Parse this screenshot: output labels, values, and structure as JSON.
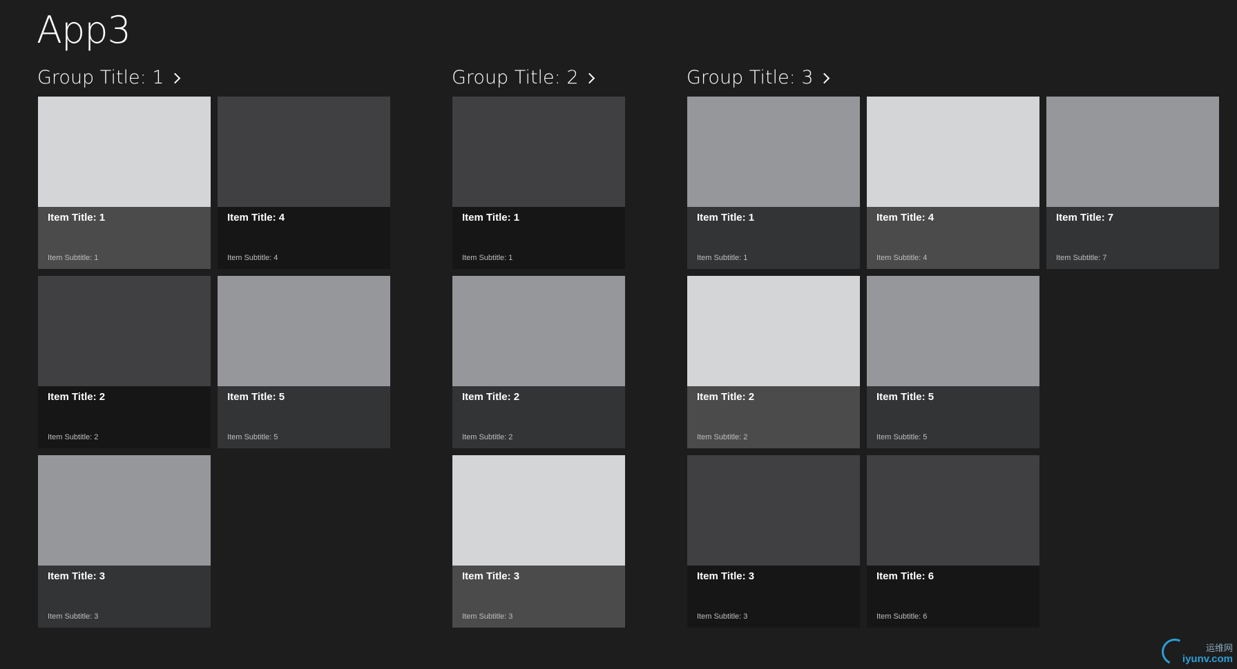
{
  "app": {
    "title": "App3"
  },
  "colors": {
    "background": "#1d1d1d",
    "shade_light": "#d4d5d7",
    "shade_mid": "#96979b",
    "shade_dark": "#404042"
  },
  "groups": [
    {
      "title": "Group Title: 1",
      "items": [
        {
          "title": "Item Title: 1",
          "subtitle": "Item Subtitle: 1",
          "image_color": "#d4d5d7",
          "caption_color": "#4b4b4b"
        },
        {
          "title": "Item Title: 2",
          "subtitle": "Item Subtitle: 2",
          "image_color": "#404042",
          "caption_color": "#161617"
        },
        {
          "title": "Item Title: 3",
          "subtitle": "Item Subtitle: 3",
          "image_color": "#96979b",
          "caption_color": "#333436"
        },
        {
          "title": "Item Title: 4",
          "subtitle": "Item Subtitle: 4",
          "image_color": "#404042",
          "caption_color": "#161617"
        },
        {
          "title": "Item Title: 5",
          "subtitle": "Item Subtitle: 5",
          "image_color": "#96979b",
          "caption_color": "#333436"
        }
      ]
    },
    {
      "title": "Group Title: 2",
      "items": [
        {
          "title": "Item Title: 1",
          "subtitle": "Item Subtitle: 1",
          "image_color": "#404042",
          "caption_color": "#161617"
        },
        {
          "title": "Item Title: 2",
          "subtitle": "Item Subtitle: 2",
          "image_color": "#96979b",
          "caption_color": "#333436"
        },
        {
          "title": "Item Title: 3",
          "subtitle": "Item Subtitle: 3",
          "image_color": "#d4d5d7",
          "caption_color": "#4b4b4b"
        }
      ]
    },
    {
      "title": "Group Title: 3",
      "items": [
        {
          "title": "Item Title: 1",
          "subtitle": "Item Subtitle: 1",
          "image_color": "#96979b",
          "caption_color": "#333436"
        },
        {
          "title": "Item Title: 2",
          "subtitle": "Item Subtitle: 2",
          "image_color": "#d4d5d7",
          "caption_color": "#4b4b4b"
        },
        {
          "title": "Item Title: 3",
          "subtitle": "Item Subtitle: 3",
          "image_color": "#404042",
          "caption_color": "#161617"
        },
        {
          "title": "Item Title: 4",
          "subtitle": "Item Subtitle: 4",
          "image_color": "#d4d5d7",
          "caption_color": "#4b4b4b"
        },
        {
          "title": "Item Title: 5",
          "subtitle": "Item Subtitle: 5",
          "image_color": "#96979b",
          "caption_color": "#333436"
        },
        {
          "title": "Item Title: 6",
          "subtitle": "Item Subtitle: 6",
          "image_color": "#404042",
          "caption_color": "#161617"
        },
        {
          "title": "Item Title: 7",
          "subtitle": "Item Subtitle: 7",
          "image_color": "#96979b",
          "caption_color": "#333436"
        }
      ]
    }
  ],
  "watermark": {
    "cn_text": "运维网",
    "en_text": "iyunv.com"
  }
}
